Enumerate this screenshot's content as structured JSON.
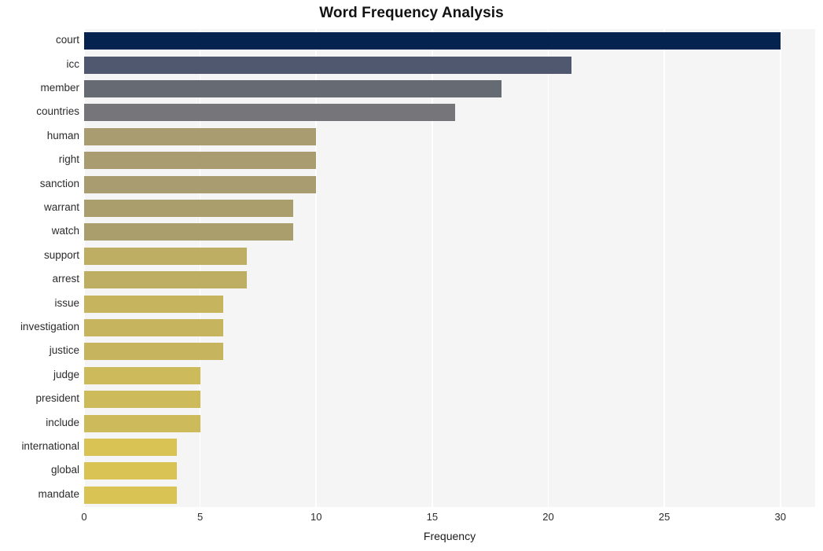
{
  "chart_data": {
    "type": "bar",
    "orientation": "horizontal",
    "title": "Word Frequency Analysis",
    "xlabel": "Frequency",
    "ylabel": "",
    "xlim": [
      0,
      31.5
    ],
    "xticks": [
      0,
      5,
      10,
      15,
      20,
      25,
      30
    ],
    "xtick_labels": [
      "0",
      "5",
      "10",
      "15",
      "20",
      "25",
      "30"
    ],
    "grid": true,
    "grid_color": "#ffffff",
    "plot_background": "#f5f5f6",
    "figure_background": "#ffffff",
    "legend": null,
    "categories": [
      "court",
      "icc",
      "member",
      "countries",
      "human",
      "right",
      "sanction",
      "warrant",
      "watch",
      "support",
      "arrest",
      "issue",
      "investigation",
      "justice",
      "judge",
      "president",
      "include",
      "international",
      "global",
      "mandate"
    ],
    "values": [
      30,
      21,
      18,
      16,
      10,
      10,
      10,
      9,
      9,
      7,
      7,
      6,
      6,
      6,
      5,
      5,
      5,
      4,
      4,
      4
    ],
    "bar_colors": [
      "#04244f",
      "#4f586f",
      "#666a72",
      "#76767a",
      "#a89c70",
      "#a89c70",
      "#a89c70",
      "#aa9e6d",
      "#aa9e6d",
      "#bdae63",
      "#bdae63",
      "#c6b55e",
      "#c6b55e",
      "#c6b55e",
      "#cdbb5b",
      "#cdbb5b",
      "#cdbb5b",
      "#d9c355",
      "#d9c355",
      "#d9c355"
    ]
  }
}
